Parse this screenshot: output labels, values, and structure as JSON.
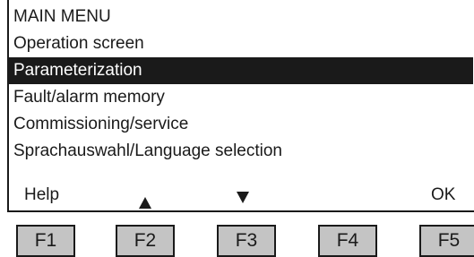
{
  "screen": {
    "title": "MAIN MENU",
    "items": [
      {
        "label": "Operation screen",
        "selected": false
      },
      {
        "label": "Parameterization",
        "selected": true
      },
      {
        "label": "Fault/alarm memory",
        "selected": false
      },
      {
        "label": "Commissioning/service",
        "selected": false
      },
      {
        "label": "Sprachauswahl/Language selection",
        "selected": false
      }
    ]
  },
  "softkeys": {
    "f1_label": "Help",
    "f2_icon": "up-arrow-icon",
    "f3_icon": "down-arrow-icon",
    "f5_label": "OK"
  },
  "keys": [
    "F1",
    "F2",
    "F3",
    "F4",
    "F5"
  ],
  "colors": {
    "text": "#1a1a1a",
    "selection_background": "#1a1a1a",
    "selection_text": "#ffffff",
    "key_face": "#c4c4c4"
  }
}
